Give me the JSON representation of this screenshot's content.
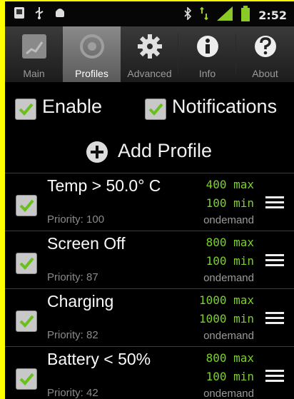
{
  "status_bar": {
    "icons_left": [
      "sim-card-icon",
      "usb-icon",
      "android-icon"
    ],
    "icons_right": [
      "bluetooth-icon",
      "signal-arrows-icon",
      "cell-signal-icon",
      "battery-icon"
    ],
    "time": "2:52"
  },
  "tabs": [
    {
      "label": "Main",
      "icon": "main-icon",
      "active": false
    },
    {
      "label": "Profiles",
      "icon": "profiles-icon",
      "active": true
    },
    {
      "label": "Advanced",
      "icon": "gear-icon",
      "active": false
    },
    {
      "label": "Info",
      "icon": "info-icon",
      "active": false
    },
    {
      "label": "About",
      "icon": "question-icon",
      "active": false
    }
  ],
  "toggles": {
    "enable": {
      "label": "Enable",
      "checked": true
    },
    "notifications": {
      "label": "Notifications",
      "checked": true
    }
  },
  "add_profile": {
    "label": "Add Profile"
  },
  "profiles": [
    {
      "name": "Temp > 50.0° C",
      "max": "400 max",
      "min": "100 min",
      "governor": "ondemand",
      "priority": "Priority: 100",
      "checked": true
    },
    {
      "name": "Screen Off",
      "max": "800 max",
      "min": "100 min",
      "governor": "ondemand",
      "priority": "Priority: 87",
      "checked": true
    },
    {
      "name": "Charging",
      "max": "1000 max",
      "min": "1000 min",
      "governor": "ondemand",
      "priority": "Priority: 82",
      "checked": true
    },
    {
      "name": "Battery < 50%",
      "max": "800 max",
      "min": "100 min",
      "governor": "ondemand",
      "priority": "Priority: 42",
      "checked": true
    }
  ],
  "colors": {
    "frame": "#ffff00",
    "accent_green": "#7bd02a",
    "checkmark": "#69c01a"
  }
}
